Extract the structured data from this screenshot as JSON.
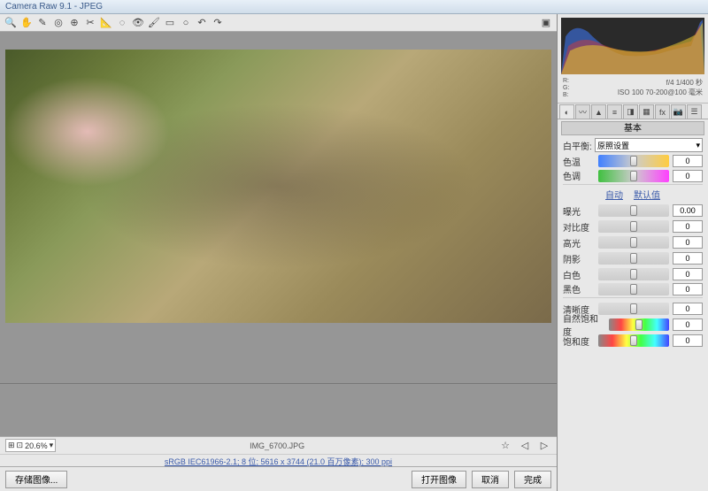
{
  "title": "Camera Raw 9.1 - JPEG",
  "readout": {
    "rgb_label": "R:\nG:\nB:",
    "exposure_info": "f/4  1/400 秒",
    "iso_info": "ISO 100  70-200@100 毫米"
  },
  "panel": {
    "title": "基本",
    "wb_label": "白平衡:",
    "wb_value": "原照设置",
    "auto_label": "自动",
    "default_label": "默认值"
  },
  "sliders": {
    "temp": {
      "label": "色温",
      "value": "0"
    },
    "tint": {
      "label": "色调",
      "value": "0"
    },
    "exposure": {
      "label": "曝光",
      "value": "0.00"
    },
    "contrast": {
      "label": "对比度",
      "value": "0"
    },
    "highlights": {
      "label": "高光",
      "value": "0"
    },
    "shadows": {
      "label": "阴影",
      "value": "0"
    },
    "whites": {
      "label": "白色",
      "value": "0"
    },
    "blacks": {
      "label": "黑色",
      "value": "0"
    },
    "clarity": {
      "label": "清晰度",
      "value": "0"
    },
    "vibrance": {
      "label": "自然饱和度",
      "value": "0"
    },
    "saturation": {
      "label": "饱和度",
      "value": "0"
    }
  },
  "zoom": "20.6%",
  "filename": "IMG_6700.JPG",
  "metadata_link": "sRGB IEC61966-2.1; 8 位; 5616 x 3744 (21.0 百万像素); 300 ppi",
  "buttons": {
    "save": "存储图像...",
    "open": "打开图像",
    "cancel": "取消",
    "done": "完成"
  }
}
